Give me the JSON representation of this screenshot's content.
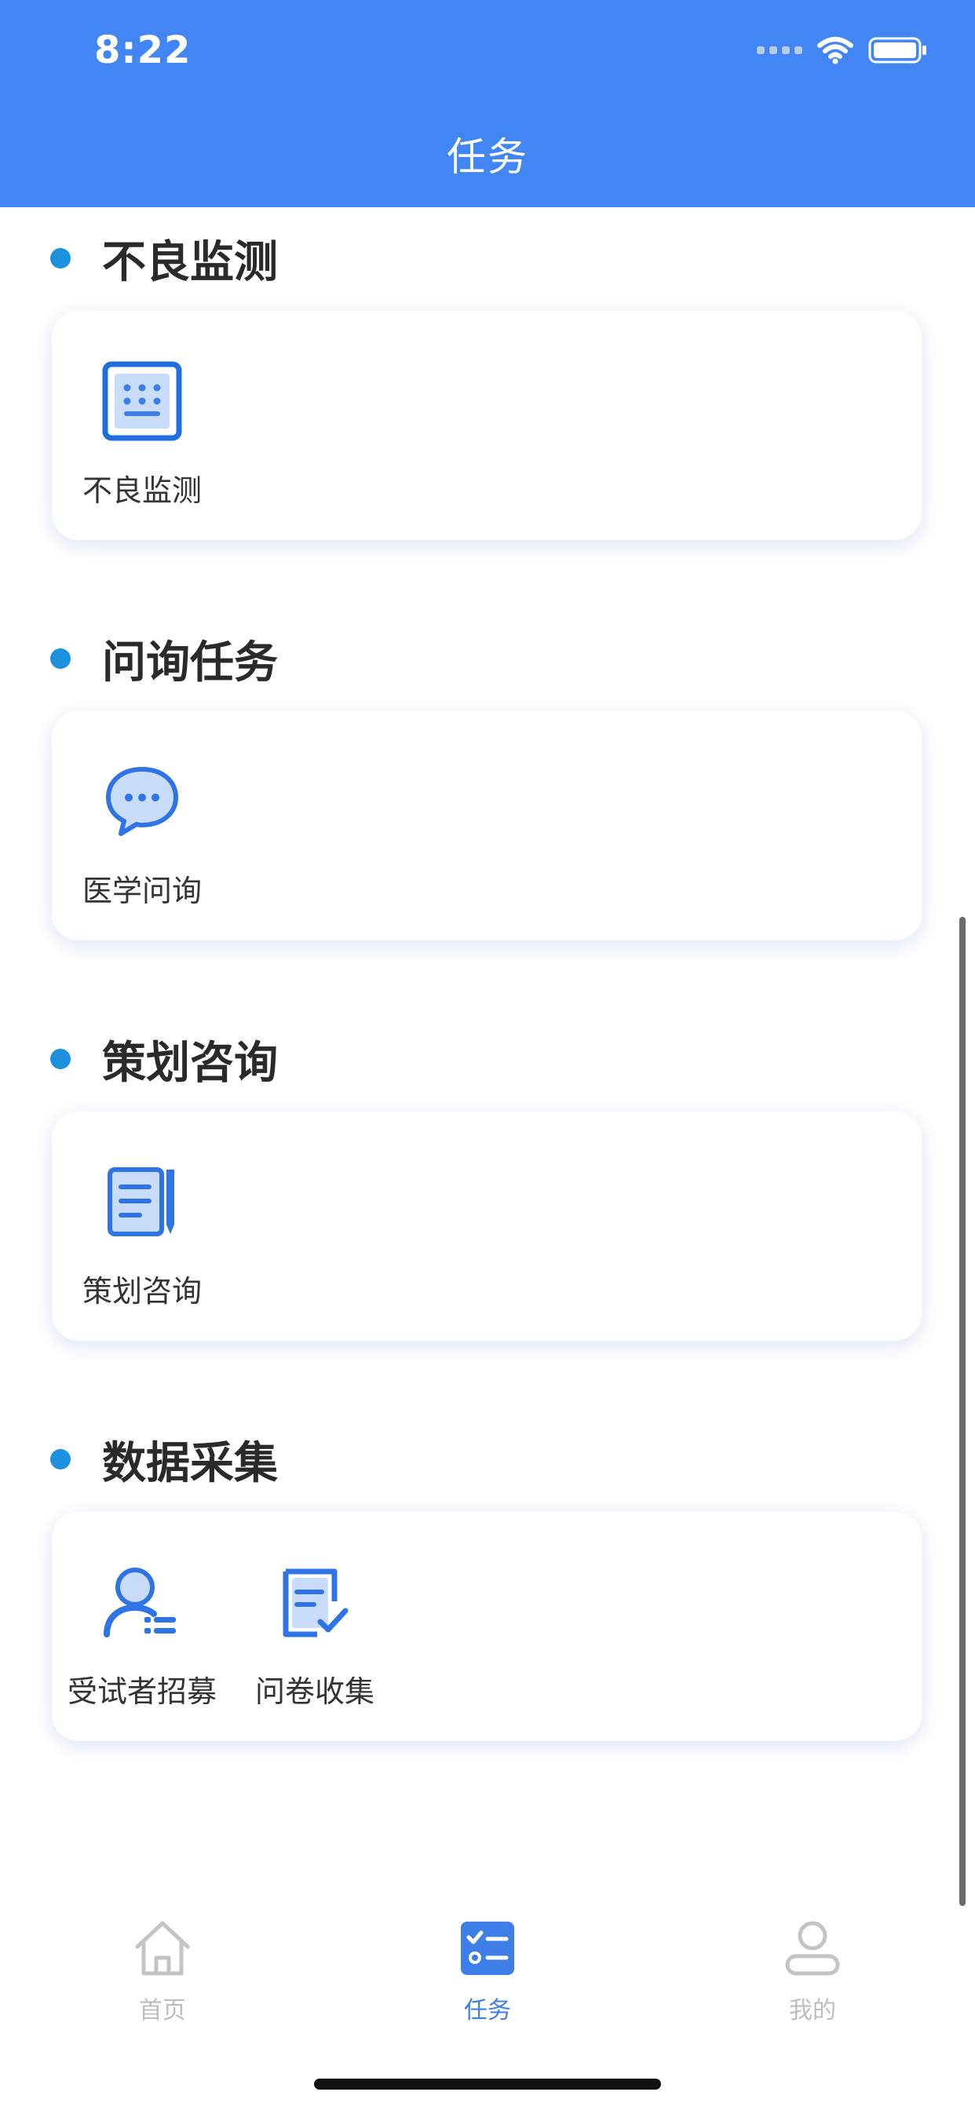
{
  "status_bar": {
    "time": "8:22"
  },
  "header": {
    "title": "任务"
  },
  "sections": [
    {
      "title": "不良监测",
      "items": [
        {
          "label": "不良监测",
          "icon": "monitor-keypad-icon"
        }
      ]
    },
    {
      "title": "问询任务",
      "items": [
        {
          "label": "医学问询",
          "icon": "chat-bubble-icon"
        }
      ]
    },
    {
      "title": "策划咨询",
      "items": [
        {
          "label": "策划咨询",
          "icon": "notebook-pen-icon"
        }
      ]
    },
    {
      "title": "数据采集",
      "items": [
        {
          "label": "受试者招募",
          "icon": "person-list-icon"
        },
        {
          "label": "问卷收集",
          "icon": "document-check-icon"
        }
      ]
    }
  ],
  "tabbar": {
    "items": [
      {
        "label": "首页",
        "icon": "home-icon",
        "active": false
      },
      {
        "label": "任务",
        "icon": "task-list-icon",
        "active": true
      },
      {
        "label": "我的",
        "icon": "user-icon",
        "active": false
      }
    ]
  },
  "colors": {
    "primary": "#4285f4",
    "section_dot": "#1e90e0",
    "tab_active": "#3d7ee8",
    "tab_inactive": "#bdbdbd"
  }
}
